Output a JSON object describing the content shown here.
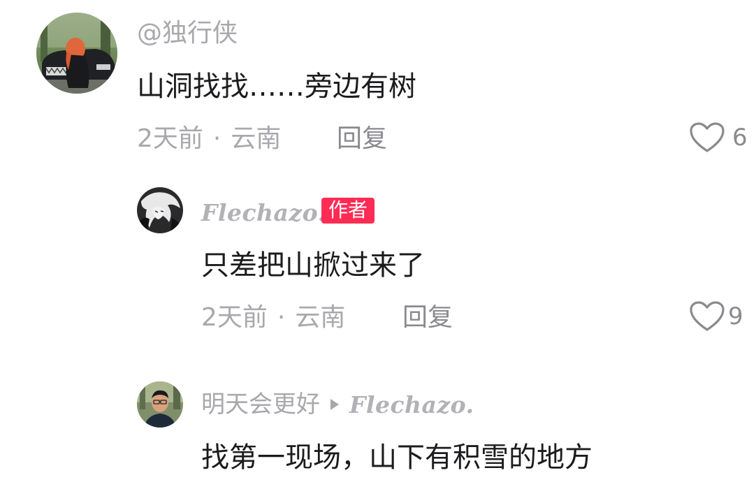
{
  "comments": [
    {
      "username": "@独行侠",
      "text": "山洞找找……旁边有树",
      "time": "2天前",
      "location": "云南",
      "separator": "·",
      "reply_label": "回复",
      "likes": "6",
      "avatar_icon": "woman-by-car-avatar"
    },
    {
      "username": "Flechazo.",
      "badge": "作者",
      "text": "只差把山掀过来了",
      "time": "2天前",
      "location": "云南",
      "separator": "·",
      "reply_label": "回复",
      "likes": "9",
      "avatar_icon": "anime-character-avatar"
    },
    {
      "username": "明天会更好",
      "reply_to": "Flechazo.",
      "text": "找第一现场，山下有积雪的地方",
      "avatar_icon": "man-portrait-avatar"
    }
  ],
  "colors": {
    "badge": "#fe2c55",
    "meta_text": "#a8a8ad",
    "body_text": "#1c1c1e"
  }
}
